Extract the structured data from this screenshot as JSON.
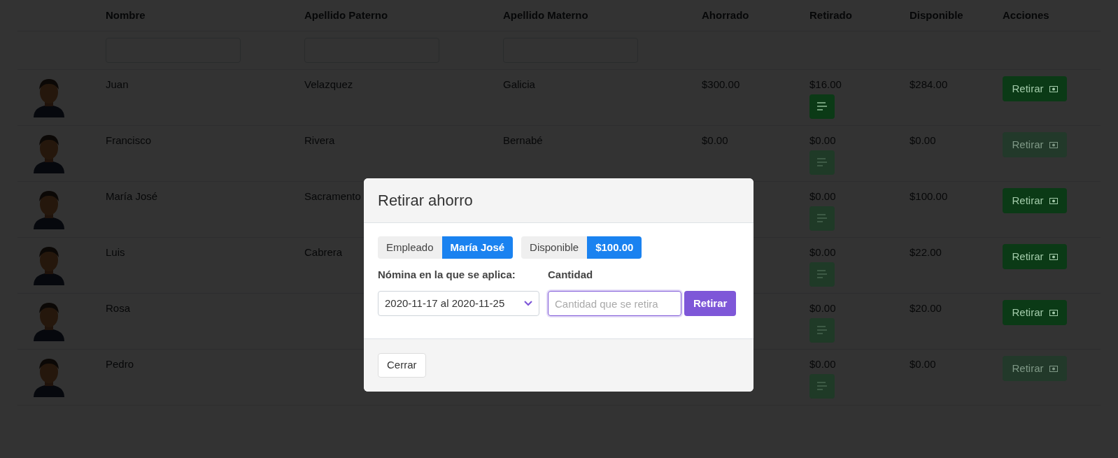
{
  "table": {
    "columns": [
      {
        "label": "Nombre",
        "filterable": true
      },
      {
        "label": "Apellido Paterno",
        "filterable": true
      },
      {
        "label": "Apellido Materno",
        "filterable": true
      },
      {
        "label": "Ahorrado",
        "filterable": false
      },
      {
        "label": "Retirado",
        "filterable": false
      },
      {
        "label": "Disponible",
        "filterable": false
      },
      {
        "label": "Acciones",
        "filterable": false
      }
    ],
    "rows": [
      {
        "name": "Juan",
        "paternal": "Velazquez",
        "maternal": "Galicia",
        "saved": "$300.00",
        "withdrawn": "$16.00",
        "available": "$284.00",
        "history_enabled": true,
        "action": "Retirar",
        "action_enabled": true
      },
      {
        "name": "Francisco",
        "paternal": "Rivera",
        "maternal": "Bernabé",
        "saved": "$0.00",
        "withdrawn": "$0.00",
        "available": "$0.00",
        "history_enabled": false,
        "action": "Retirar",
        "action_enabled": false
      },
      {
        "name": "María José",
        "paternal": "Sacramento",
        "withdrawn": "$0.00",
        "available": "$100.00",
        "history_enabled": false,
        "action": "Retirar",
        "action_enabled": true
      },
      {
        "name": "Luis",
        "paternal": "Cabrera",
        "withdrawn": "$0.00",
        "available": "$22.00",
        "history_enabled": false,
        "action": "Retirar",
        "action_enabled": true
      },
      {
        "name": "Rosa",
        "withdrawn": "$0.00",
        "available": "$20.00",
        "history_enabled": false,
        "action": "Retirar",
        "action_enabled": true
      },
      {
        "name": "Pedro",
        "withdrawn": "$0.00",
        "available": "$0.00",
        "history_enabled": false,
        "action": "Retirar",
        "action_enabled": false
      }
    ]
  },
  "modal": {
    "title": "Retirar ahorro",
    "employee": {
      "label": "Empleado",
      "value": "María José"
    },
    "available": {
      "label": "Disponible",
      "value": "$100.00"
    },
    "payroll": {
      "label": "Nómina en la que se aplica:",
      "value": "2020-11-17 al 2020-11-25"
    },
    "amount": {
      "label": "Cantidad",
      "placeholder": "Cantidad que se retira"
    },
    "submit": "Retirar",
    "close": "Cerrar"
  }
}
